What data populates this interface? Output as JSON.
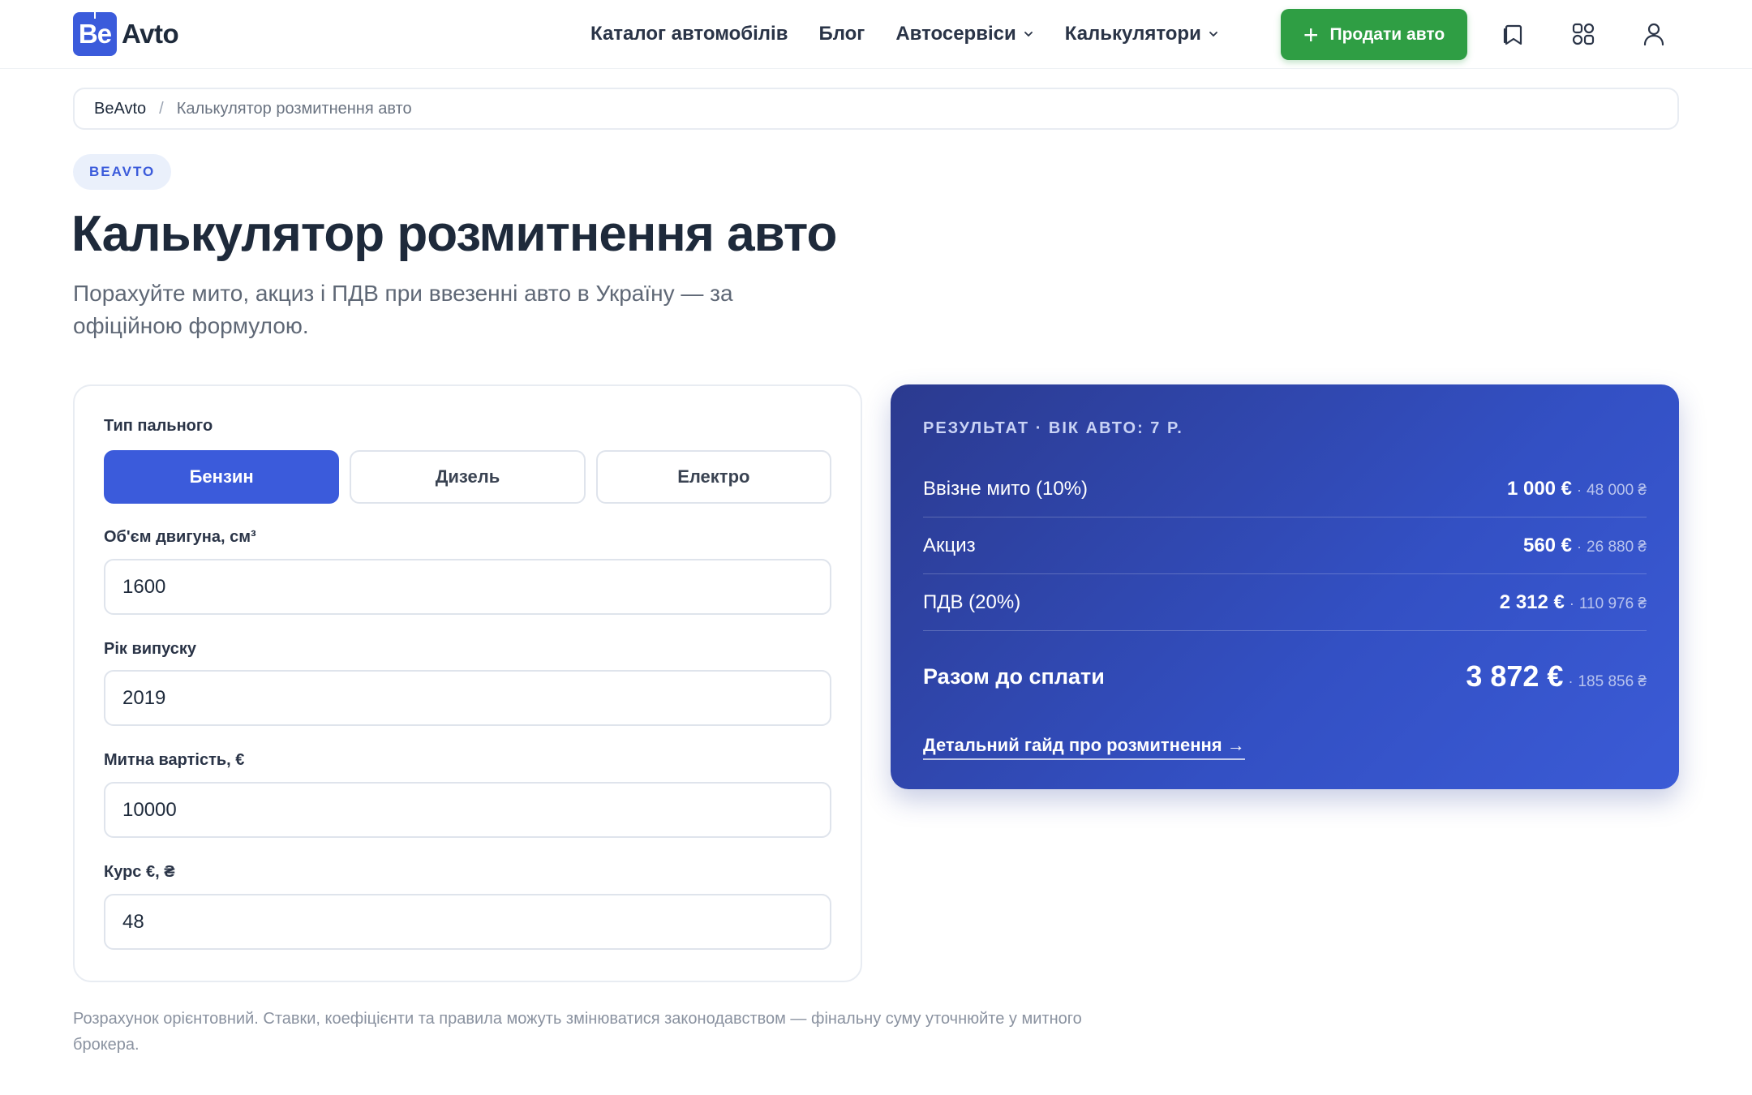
{
  "brand": {
    "logo_mark": "Be",
    "logo_text": "Avto"
  },
  "nav": {
    "catalog": "Каталог автомобілів",
    "blog": "Блог",
    "services": "Автосервіси",
    "calculators": "Калькулятори",
    "sell_button": "Продати авто"
  },
  "icons": [
    "bookmark-icon",
    "compare-icon",
    "user-icon",
    "plus-icon",
    "chevron-down-icon"
  ],
  "colors": {
    "accent": "#3b5bdb",
    "sell": "#2f9e44",
    "result_bg": "#2b3a8f"
  },
  "breadcrumb": {
    "home": "BeAvto",
    "separator": "/",
    "current": "Калькулятор розмитнення авто"
  },
  "badge": "BEAVTO",
  "title": "Калькулятор розмитнення авто",
  "subtitle": "Порахуйте мито, акциз і ПДВ при ввезенні авто в Україну — за офіційною формулою.",
  "form": {
    "fuel_label": "Тип пального",
    "fuel_options": [
      "Бензин",
      "Дизель",
      "Електро"
    ],
    "fuel_selected": "Бензин",
    "engine_label": "Об'єм двигуна, см³",
    "engine_value": "1600",
    "year_label": "Рік випуску",
    "year_value": "2019",
    "value_label": "Митна вартість, €",
    "value_value": "10000",
    "rate_label": "Курс €, ₴",
    "rate_value": "48"
  },
  "result": {
    "heading": "РЕЗУЛЬТАТ · ВІК АВТО: 7 Р.",
    "rows": [
      {
        "label": "Ввізне мито (10%)",
        "eur": "1 000 €",
        "uah": "48 000 ₴"
      },
      {
        "label": "Акциз",
        "eur": "560 €",
        "uah": "26 880 ₴"
      },
      {
        "label": "ПДВ (20%)",
        "eur": "2 312 €",
        "uah": "110 976 ₴"
      }
    ],
    "dot": "·",
    "total_label": "Разом до сплати",
    "total_eur": "3 872 €",
    "total_uah": "185 856 ₴",
    "guide_link": "Детальний гайд про розмитнення →"
  },
  "disclaimer": "Розрахунок орієнтовний. Ставки, коефіцієнти та правила можуть змінюватися законодавством — фінальну суму уточнюйте у митного брокера."
}
